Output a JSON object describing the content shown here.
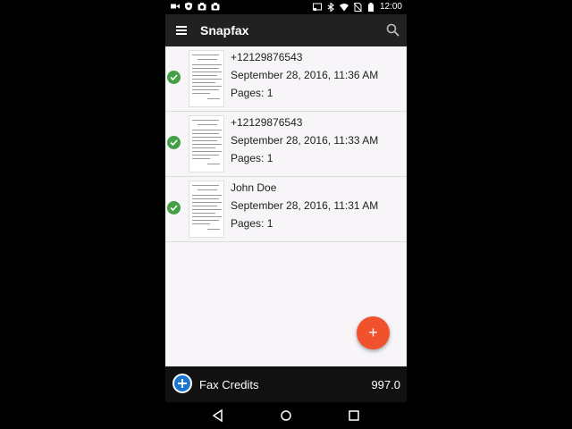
{
  "status_bar": {
    "time": "12:00",
    "icons_left": [
      "video-icon",
      "shield-icon",
      "camera-icon",
      "camera-icon"
    ],
    "icons_right": [
      "cast-icon",
      "bluetooth-icon",
      "wifi-icon",
      "no-sim-icon",
      "battery-icon"
    ]
  },
  "app_bar": {
    "title": "Snapfax",
    "menu_icon": "menu-icon",
    "search_icon": "search-icon",
    "background": "#212121"
  },
  "fax_list": [
    {
      "recipient": "+12129876543",
      "date": "September 28, 2016, 11:36 AM",
      "pages": "Pages: 1",
      "status_icon": "check-icon"
    },
    {
      "recipient": "+12129876543",
      "date": "September 28, 2016, 11:33 AM",
      "pages": "Pages: 1",
      "status_icon": "check-icon"
    },
    {
      "recipient": "John Doe",
      "date": "September 28, 2016, 11:31 AM",
      "pages": "Pages: 1",
      "status_icon": "check-icon"
    }
  ],
  "fab": {
    "label": "+",
    "color": "#f0522d"
  },
  "credits_bar": {
    "label": "Fax Credits",
    "value": "997.0",
    "add_icon": "add-circle-icon",
    "accent": "#1976d2"
  },
  "nav_bar": {
    "buttons": [
      "back-icon",
      "home-icon",
      "recents-icon"
    ]
  },
  "colors": {
    "success": "#43a047",
    "list_background": "#f7f5f8"
  }
}
